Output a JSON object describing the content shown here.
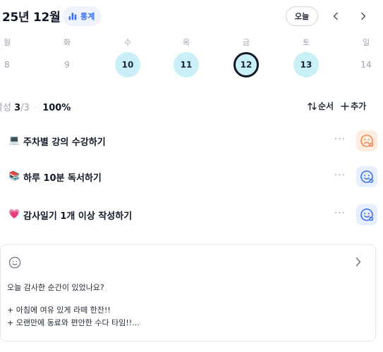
{
  "header": {
    "month": "25년 12월",
    "stats_label": "통계",
    "today_label": "오늘",
    "stats_icon": "bar-chart-icon",
    "prev_icon": "chevron-left-icon",
    "next_icon": "chevron-right-icon",
    "accent_color": "#3b6ef0"
  },
  "calendar": {
    "weekdays": [
      "월",
      "화",
      "수",
      "목",
      "금",
      "토",
      "일"
    ],
    "dates": [
      {
        "day": "8",
        "state": "none"
      },
      {
        "day": "9",
        "state": "none"
      },
      {
        "day": "10",
        "state": "done"
      },
      {
        "day": "11",
        "state": "done"
      },
      {
        "day": "12",
        "state": "selected"
      },
      {
        "day": "13",
        "state": "done"
      },
      {
        "day": "14",
        "state": "none"
      }
    ],
    "done_color": "#c9f0f6"
  },
  "summary": {
    "label": "달성",
    "done": "3",
    "total": "/3",
    "percent": "100%",
    "progress": 1.0,
    "order_label": "순서",
    "add_label": "추가"
  },
  "tasks": [
    {
      "emoji": "💻",
      "title": "주차별 강의 수강하기",
      "more": "···",
      "mood_icon": "worried-face-icon",
      "mood_color": "#f59e6b"
    },
    {
      "emoji": "📚",
      "title": "하루 10분 독서하기",
      "more": "···",
      "mood_icon": "smile-face-icon",
      "mood_color": "#3b6ef0"
    },
    {
      "emoji": "💗",
      "title": "감사일기 1개 이상 작성하기",
      "more": "···",
      "mood_icon": "smile-face-icon",
      "mood_color": "#3b6ef0"
    }
  ],
  "diary": {
    "icon": "smiley-outline-icon",
    "question": "오늘 감사한 순간이 있었나요?",
    "lines": [
      "+ 아침에 여유 있게 라떼 한잔!!",
      "+ 오랜만에 동료와 편안한 수다 타임!!..."
    ]
  }
}
